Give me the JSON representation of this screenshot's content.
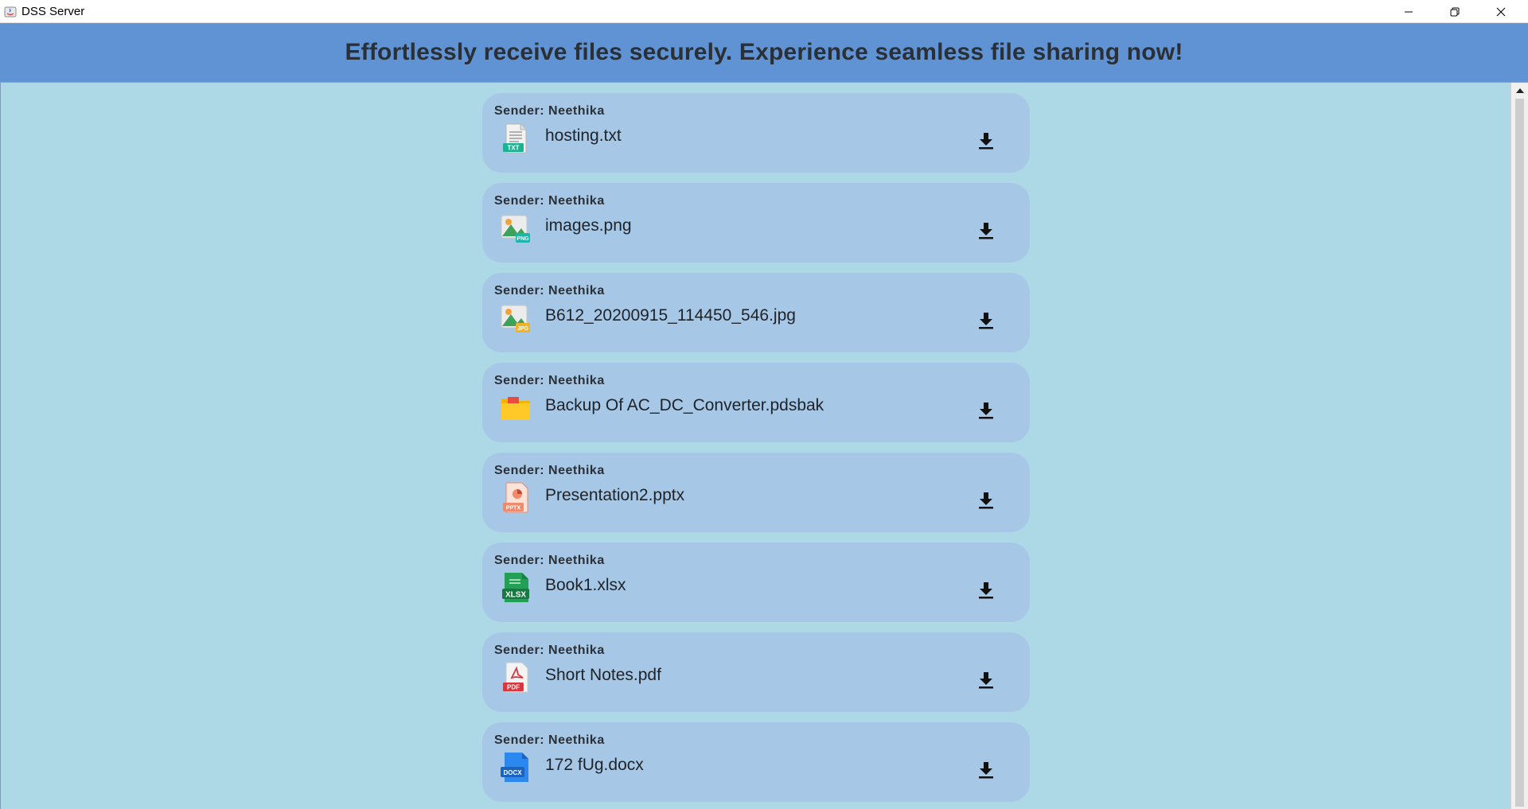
{
  "window": {
    "title": "DSS Server"
  },
  "banner": {
    "text": "Effortlessly receive files securely. Experience seamless file sharing now!"
  },
  "colors": {
    "banner_bg": "#5f93d3",
    "content_bg": "#add8e6",
    "card_bg": "#a6c8e6"
  },
  "files": [
    {
      "sender": "Sender: Neethika",
      "name": "hosting.txt",
      "icon": "txt-file-icon"
    },
    {
      "sender": "Sender: Neethika",
      "name": "images.png",
      "icon": "png-image-icon"
    },
    {
      "sender": "Sender: Neethika",
      "name": "B612_20200915_114450_546.jpg",
      "icon": "jpg-image-icon"
    },
    {
      "sender": "Sender: Neethika",
      "name": "Backup Of AC_DC_Converter.pdsbak",
      "icon": "folder-file-icon"
    },
    {
      "sender": "Sender: Neethika",
      "name": "Presentation2.pptx",
      "icon": "pptx-file-icon"
    },
    {
      "sender": "Sender: Neethika",
      "name": "Book1.xlsx",
      "icon": "xlsx-file-icon"
    },
    {
      "sender": "Sender: Neethika",
      "name": "Short Notes.pdf",
      "icon": "pdf-file-icon"
    },
    {
      "sender": "Sender: Neethika",
      "name": "172 fUg.docx",
      "icon": "docx-file-icon"
    }
  ]
}
